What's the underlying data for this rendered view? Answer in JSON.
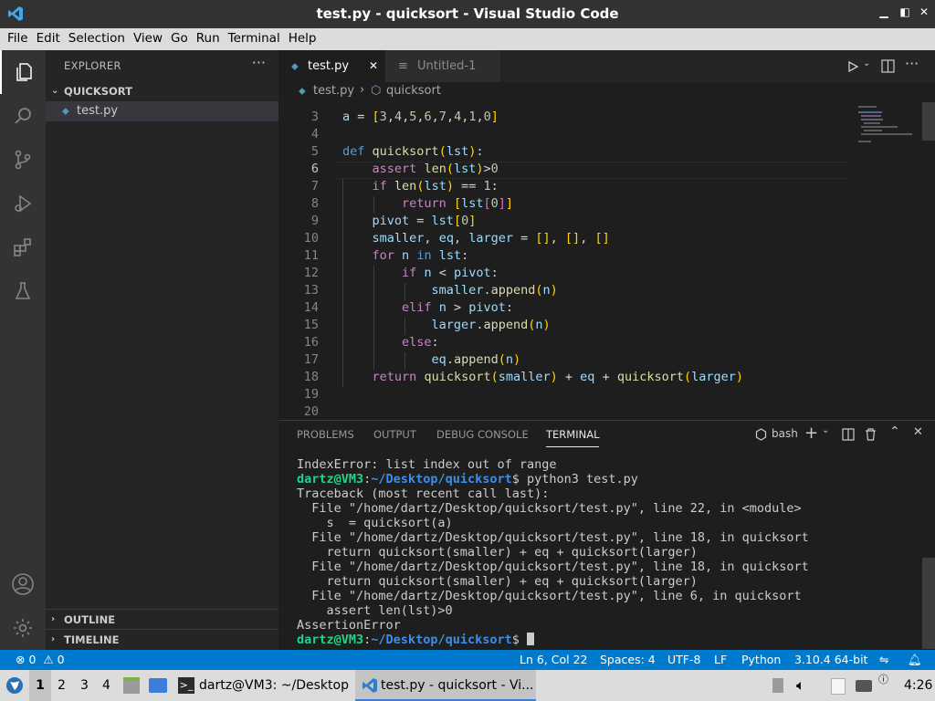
{
  "window": {
    "title": "test.py - quicksort - Visual Studio Code",
    "controls": [
      "▁",
      "◧",
      "✕"
    ]
  },
  "menu": [
    "File",
    "Edit",
    "Selection",
    "View",
    "Go",
    "Run",
    "Terminal",
    "Help"
  ],
  "sidebar": {
    "header": "EXPLORER",
    "more": "···",
    "folder": "QUICKSORT",
    "file": "test.py",
    "outline": "OUTLINE",
    "timeline": "TIMELINE"
  },
  "tabs": [
    {
      "label": "test.py",
      "close": "✕"
    },
    {
      "label": "Untitled-1"
    }
  ],
  "breadcrumb": {
    "file": "test.py",
    "symbol": "quicksort"
  },
  "editor": {
    "line_numbers": [
      "3",
      "4",
      "5",
      "6",
      "7",
      "8",
      "9",
      "10",
      "11",
      "12",
      "13",
      "14",
      "15",
      "16",
      "17",
      "18",
      "19",
      "20"
    ],
    "current_line": "6"
  },
  "panel": {
    "tabs": [
      "PROBLEMS",
      "OUTPUT",
      "DEBUG CONSOLE",
      "TERMINAL"
    ],
    "shell": "bash",
    "prompt_user": "dartz@VM3",
    "prompt_path": "~/Desktop/quicksort",
    "terminal_lines": [
      "IndexError: list index out of range",
      "Traceback (most recent call last):",
      "  File \"/home/dartz/Desktop/quicksort/test.py\", line 22, in <module>",
      "    s  = quicksort(a)",
      "  File \"/home/dartz/Desktop/quicksort/test.py\", line 18, in quicksort",
      "    return quicksort(smaller) + eq + quicksort(larger)",
      "  File \"/home/dartz/Desktop/quicksort/test.py\", line 18, in quicksort",
      "    return quicksort(smaller) + eq + quicksort(larger)",
      "  File \"/home/dartz/Desktop/quicksort/test.py\", line 6, in quicksort",
      "    assert len(lst)>0",
      "AssertionError"
    ],
    "command": "$ python3 test.py",
    "prompt_end": "$"
  },
  "status": {
    "errors": "0",
    "warnings": "0",
    "position": "Ln 6, Col 22",
    "spaces": "Spaces: 4",
    "encoding": "UTF-8",
    "eol": "LF",
    "language": "Python",
    "interpreter": "3.10.4 64-bit"
  },
  "taskbar": {
    "workspaces": [
      "1",
      "2",
      "3",
      "4"
    ],
    "terminal_task": "dartz@VM3: ~/Desktop",
    "vscode_task": "test.py - quicksort - Vi...",
    "clock": "4:26"
  }
}
